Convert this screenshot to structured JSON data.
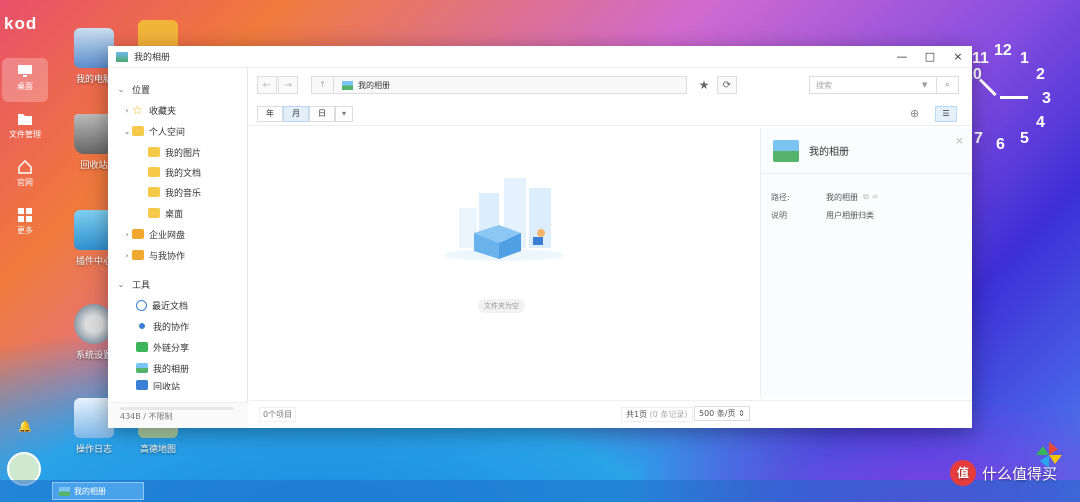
{
  "logo": "kod",
  "dock": {
    "items": [
      {
        "label": "桌面"
      },
      {
        "label": "文件管理"
      },
      {
        "label": "官网"
      },
      {
        "label": "更多"
      }
    ]
  },
  "desktop": {
    "icons": [
      {
        "label": "我的电脑"
      },
      {
        "label": "回收站"
      },
      {
        "label": "插件中心"
      },
      {
        "label": "系统设置"
      },
      {
        "label": "操作日志"
      },
      {
        "label": "高德地图"
      }
    ]
  },
  "clock": {
    "numbers": [
      "12",
      "1",
      "2",
      "3",
      "4",
      "5",
      "6",
      "7",
      "11",
      "10"
    ]
  },
  "window": {
    "title": "我的相册",
    "controls": {
      "close": "×",
      "minimize": "—",
      "maximize": "□"
    }
  },
  "sidebar": {
    "section_location": "位置",
    "favorites": "收藏夹",
    "personal_space": "个人空间",
    "my_pictures": "我的图片",
    "my_documents": "我的文档",
    "my_music": "我的音乐",
    "desktop": "桌面",
    "enterprise_disk": "企业网盘",
    "shared_with_me": "与我协作",
    "section_tools": "工具",
    "recent_docs": "最近文档",
    "my_collab": "我的协作",
    "external_share": "外链分享",
    "my_album": "我的相册",
    "recycle_bin": "回收站",
    "storage": "434B / 不限制"
  },
  "toolbar": {
    "path": "我的相册",
    "search_placeholder": "搜索"
  },
  "viewbar": {
    "year": "年",
    "month": "月",
    "day": "日"
  },
  "content": {
    "empty_text": "文件夹为空"
  },
  "info": {
    "title": "我的相册",
    "path_label": "路径:",
    "path_value": "我的相册",
    "desc_label": "说明",
    "desc_value": "用户相册归类"
  },
  "status": {
    "items_count": "0个项目",
    "page_info": "共1页",
    "page_records": "(0 条记录)",
    "per_page": "500 条/页"
  },
  "taskbar": {
    "active_window": "我的相册"
  },
  "watermark": {
    "badge": "值",
    "text": "什么值得买"
  }
}
